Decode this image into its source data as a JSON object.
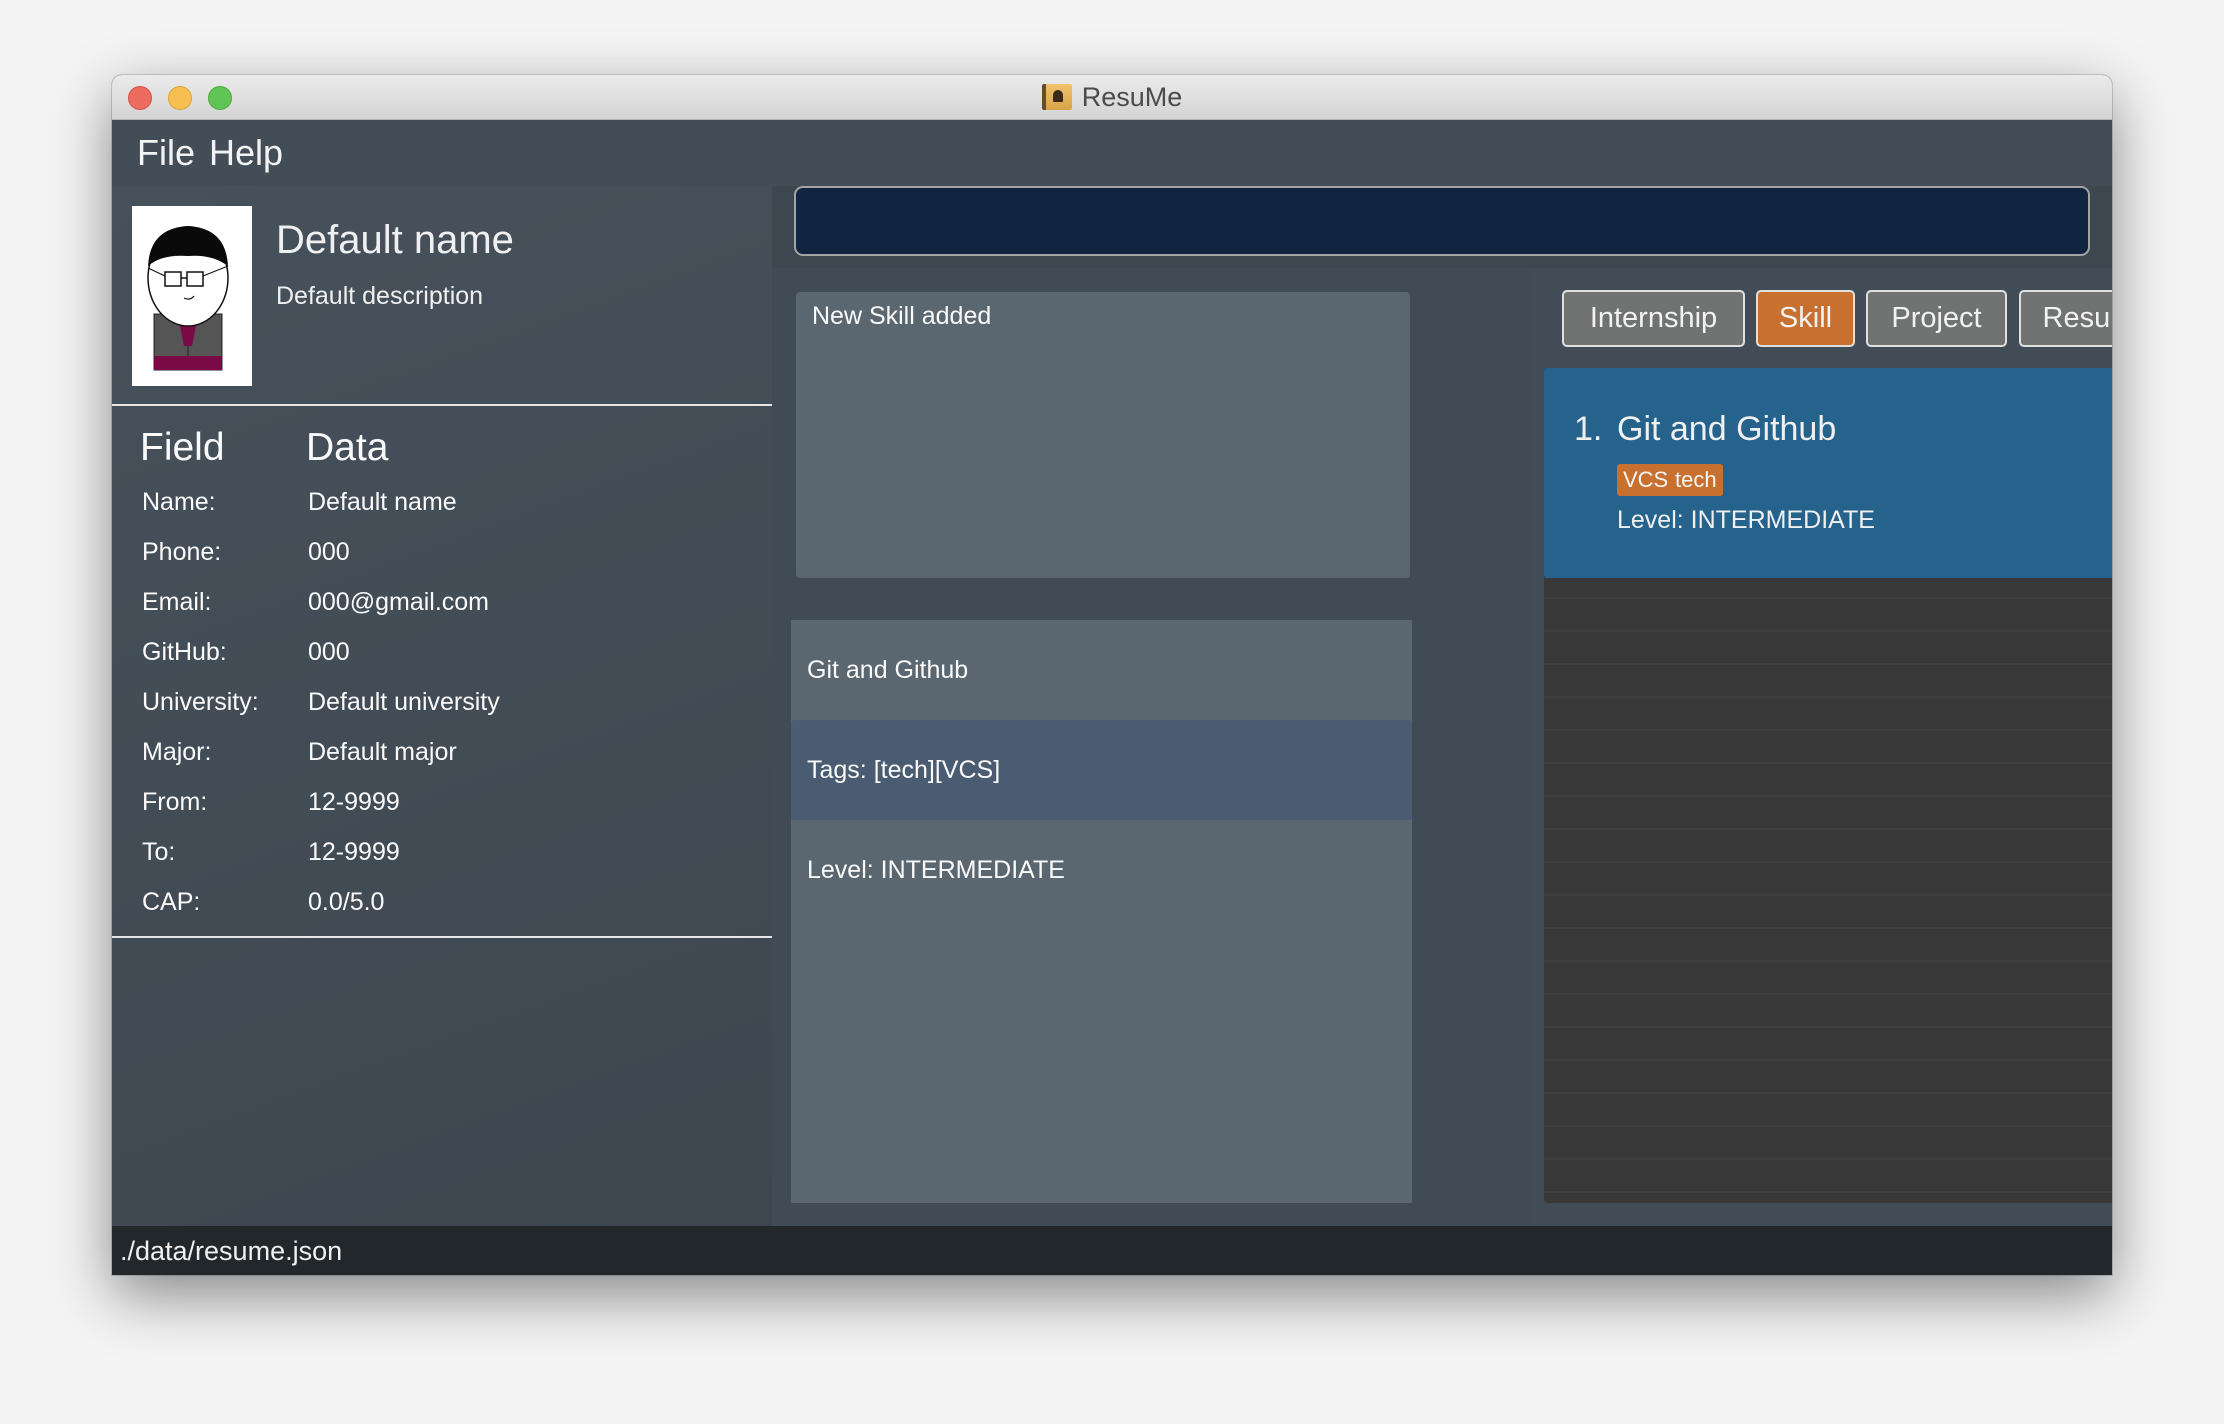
{
  "window": {
    "title": "ResuMe",
    "app_icon": "address-book-icon"
  },
  "menu": {
    "items": [
      {
        "label": "File"
      },
      {
        "label": "Help"
      }
    ]
  },
  "profile": {
    "name": "Default name",
    "description": "Default description",
    "avatar": "cartoon-person-avatar"
  },
  "fields": {
    "header_field": "Field",
    "header_data": "Data",
    "rows": [
      {
        "label": "Name:",
        "value": "Default name"
      },
      {
        "label": "Phone:",
        "value": "000"
      },
      {
        "label": "Email:",
        "value": "000@gmail.com"
      },
      {
        "label": "GitHub:",
        "value": "000"
      },
      {
        "label": "University:",
        "value": "Default university"
      },
      {
        "label": "Major:",
        "value": "Default major"
      },
      {
        "label": "From:",
        "value": "12-9999"
      },
      {
        "label": "To:",
        "value": "12-9999"
      },
      {
        "label": "CAP:",
        "value": "0.0/5.0"
      }
    ]
  },
  "command": {
    "value": "",
    "placeholder": ""
  },
  "result": {
    "message": "New Skill added"
  },
  "detail": {
    "rows": [
      {
        "text": "Git and Github",
        "selected": false
      },
      {
        "text": "Tags: [tech][VCS]",
        "selected": true
      },
      {
        "text": "Level: INTERMEDIATE",
        "selected": false
      }
    ]
  },
  "tabs": [
    {
      "label": "Internship",
      "active": false
    },
    {
      "label": "Skill",
      "active": true
    },
    {
      "label": "Project",
      "active": false
    },
    {
      "label": "Resume",
      "active": false
    }
  ],
  "items": [
    {
      "index": "1.",
      "title": "Git and Github",
      "tags": [
        "VCS",
        "tech"
      ],
      "level": "Level: INTERMEDIATE"
    }
  ],
  "status": {
    "file_path": "./data/resume.json"
  },
  "colors": {
    "accent_orange": "#c8702f",
    "selected_blue": "#25628c",
    "command_bg": "#112541",
    "status_bar": "#22272b"
  }
}
